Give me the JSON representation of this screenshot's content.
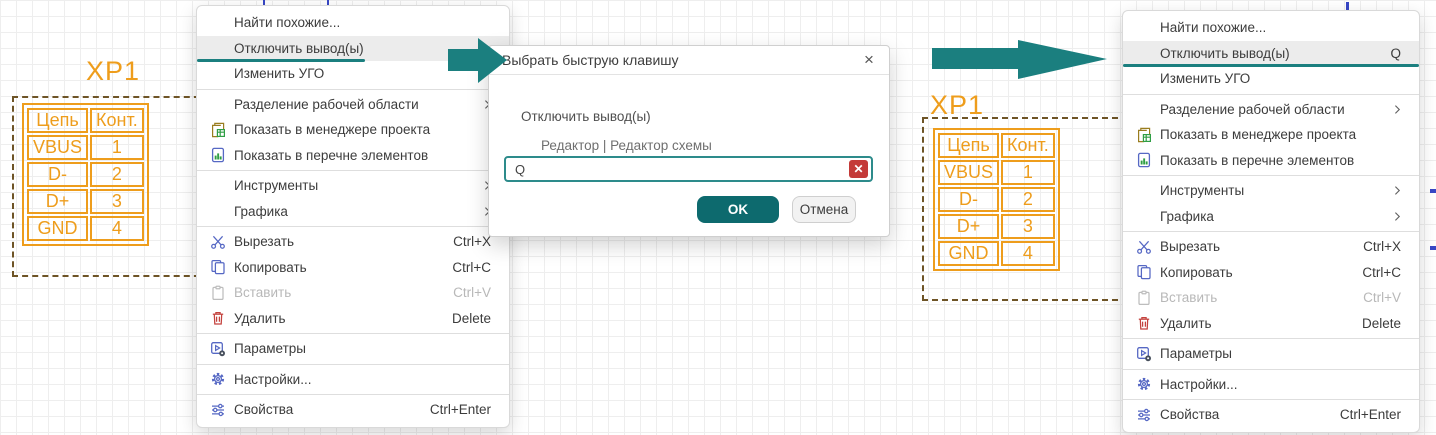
{
  "palette": {
    "accent_teal": "#1b7f7f",
    "schematic_orange": "#ee9d1c",
    "selection_dash_brown": "#6e5426",
    "menu_highlight": "#ececec",
    "ok_button_teal": "#0d6a6e",
    "clear_button_red": "#c43a38",
    "icon_blue": "#5668c4",
    "icon_red": "#c4423d",
    "icon_green": "#2f9e44",
    "icon_olive": "#9a7d1f"
  },
  "schematic_left": {
    "designator": "XP1",
    "table": {
      "headers": [
        "Цепь",
        "Конт."
      ],
      "rows": [
        [
          "VBUS",
          "1"
        ],
        [
          "D-",
          "2"
        ],
        [
          "D+",
          "3"
        ],
        [
          "GND",
          "4"
        ]
      ]
    }
  },
  "schematic_right": {
    "designator": "XP1",
    "table": {
      "headers": [
        "Цепь",
        "Конт."
      ],
      "rows": [
        [
          "VBUS",
          "1"
        ],
        [
          "D-",
          "2"
        ],
        [
          "D+",
          "3"
        ],
        [
          "GND",
          "4"
        ]
      ]
    }
  },
  "menus": {
    "left": {
      "items": [
        {
          "label": "Найти похожие...",
          "icon": null,
          "shortcut": "",
          "state": "normal"
        },
        {
          "label": "Отключить вывод(ы)",
          "icon": null,
          "shortcut": "",
          "state": "highlighted",
          "underline": "partial"
        },
        {
          "label": "Изменить УГО",
          "icon": null,
          "shortcut": "",
          "state": "normal",
          "sep_after": true
        },
        {
          "label": "Разделение рабочей области",
          "icon": null,
          "shortcut": "",
          "state": "normal",
          "submenu": true
        },
        {
          "label": "Показать в менеджере проекта",
          "icon": "project-manager-icon",
          "shortcut": "",
          "state": "normal"
        },
        {
          "label": "Показать в перечне элементов",
          "icon": "element-list-icon",
          "shortcut": "",
          "state": "normal",
          "sep_after": true
        },
        {
          "label": "Инструменты",
          "icon": null,
          "shortcut": "",
          "state": "normal",
          "submenu": true
        },
        {
          "label": "Графика",
          "icon": null,
          "shortcut": "",
          "state": "normal",
          "submenu": true,
          "sep_after": true
        },
        {
          "label": "Вырезать",
          "icon": "cut-icon",
          "shortcut": "Ctrl+X",
          "state": "normal"
        },
        {
          "label": "Копировать",
          "icon": "copy-icon",
          "shortcut": "Ctrl+C",
          "state": "normal"
        },
        {
          "label": "Вставить",
          "icon": "paste-icon",
          "shortcut": "Ctrl+V",
          "state": "disabled"
        },
        {
          "label": "Удалить",
          "icon": "delete-icon",
          "shortcut": "Delete",
          "state": "normal",
          "sep_after": true
        },
        {
          "label": "Параметры",
          "icon": "parameters-icon",
          "shortcut": "",
          "state": "normal",
          "sep_after": true
        },
        {
          "label": "Настройки...",
          "icon": "settings-icon",
          "shortcut": "",
          "state": "normal",
          "sep_after": true
        },
        {
          "label": "Свойства",
          "icon": "properties-icon",
          "shortcut": "Ctrl+Enter",
          "state": "normal"
        }
      ]
    },
    "right": {
      "items": [
        {
          "label": "Найти похожие...",
          "icon": null,
          "shortcut": "",
          "state": "normal"
        },
        {
          "label": "Отключить вывод(ы)",
          "icon": null,
          "shortcut": "Q",
          "state": "highlighted",
          "underline": "full"
        },
        {
          "label": "Изменить УГО",
          "icon": null,
          "shortcut": "",
          "state": "normal",
          "sep_after": true
        },
        {
          "label": "Разделение рабочей области",
          "icon": null,
          "shortcut": "",
          "state": "normal",
          "submenu": true
        },
        {
          "label": "Показать в менеджере проекта",
          "icon": "project-manager-icon",
          "shortcut": "",
          "state": "normal"
        },
        {
          "label": "Показать в перечне элементов",
          "icon": "element-list-icon",
          "shortcut": "",
          "state": "normal",
          "sep_after": true
        },
        {
          "label": "Инструменты",
          "icon": null,
          "shortcut": "",
          "state": "normal",
          "submenu": true
        },
        {
          "label": "Графика",
          "icon": null,
          "shortcut": "",
          "state": "normal",
          "submenu": true,
          "sep_after": true
        },
        {
          "label": "Вырезать",
          "icon": "cut-icon",
          "shortcut": "Ctrl+X",
          "state": "normal"
        },
        {
          "label": "Копировать",
          "icon": "copy-icon",
          "shortcut": "Ctrl+C",
          "state": "normal"
        },
        {
          "label": "Вставить",
          "icon": "paste-icon",
          "shortcut": "Ctrl+V",
          "state": "disabled"
        },
        {
          "label": "Удалить",
          "icon": "delete-icon",
          "shortcut": "Delete",
          "state": "normal",
          "sep_after": true
        },
        {
          "label": "Параметры",
          "icon": "parameters-icon",
          "shortcut": "",
          "state": "normal",
          "sep_after": true
        },
        {
          "label": "Настройки...",
          "icon": "settings-icon",
          "shortcut": "",
          "state": "normal",
          "sep_after": true
        },
        {
          "label": "Свойства",
          "icon": "properties-icon",
          "shortcut": "Ctrl+Enter",
          "state": "normal"
        }
      ]
    }
  },
  "dialog": {
    "title": "Выбрать быструю клавишу",
    "close_icon": "close-icon",
    "action_label": "Отключить вывод(ы)",
    "context_label": "Редактор | Редактор схемы",
    "input_value": "Q",
    "clear_icon": "clear-icon",
    "ok_label": "OK",
    "cancel_label": "Отмена"
  },
  "arrows": {
    "color": "#1b7f7f"
  }
}
